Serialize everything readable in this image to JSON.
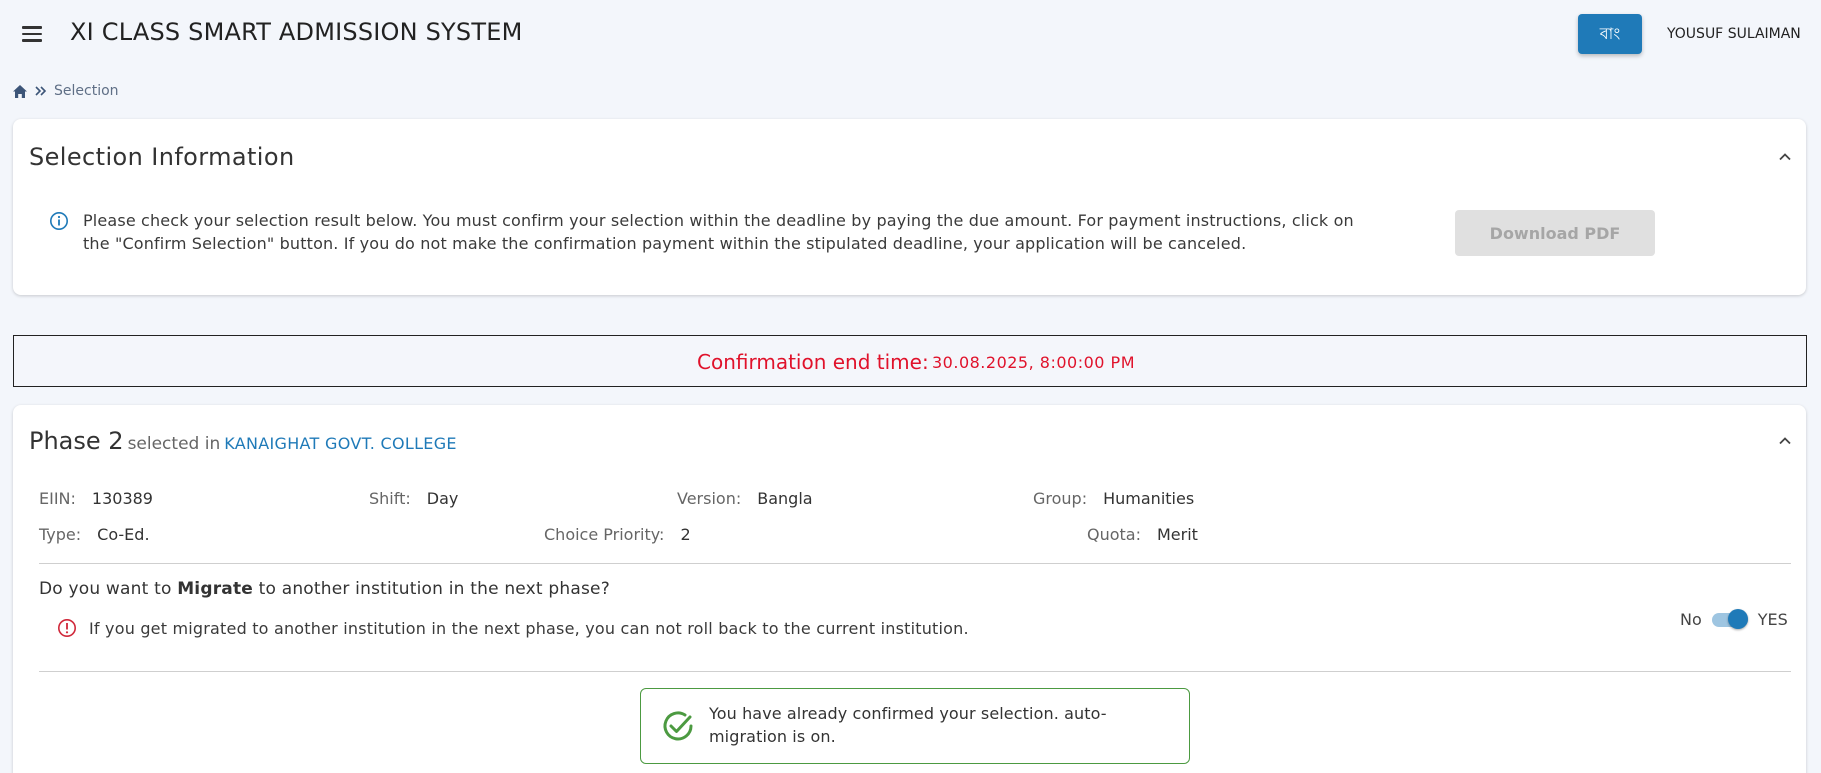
{
  "header": {
    "title": "XI CLASS SMART ADMISSION SYSTEM",
    "language_button": "বাং",
    "user_name": "YOUSUF SULAIMAN"
  },
  "breadcrumb": {
    "current": "Selection"
  },
  "selection_info": {
    "title": "Selection Information",
    "message": "Please check your selection result below. You must confirm your selection within the deadline by paying the due amount. For payment instructions, click on the \"Confirm Selection\" button. If you do not make the confirmation payment within the stipulated deadline, your application will be canceled.",
    "download_button": "Download PDF"
  },
  "confirmation": {
    "label": "Confirmation end time:",
    "value": "30.08.2025, 8:00:00 PM"
  },
  "phase": {
    "title": "Phase 2",
    "selected_in": "selected in",
    "college": "KANAIGHAT GOVT. COLLEGE",
    "fields": {
      "eiin_label": "EIIN:",
      "eiin_value": "130389",
      "shift_label": "Shift:",
      "shift_value": "Day",
      "version_label": "Version:",
      "version_value": "Bangla",
      "group_label": "Group:",
      "group_value": "Humanities",
      "type_label": "Type:",
      "type_value": "Co-Ed.",
      "priority_label": "Choice Priority:",
      "priority_value": "2",
      "quota_label": "Quota:",
      "quota_value": "Merit"
    },
    "migrate": {
      "question_prefix": "Do you want to",
      "question_bold": "Migrate",
      "question_suffix": "to another institution in the next phase?",
      "warning": "If you get migrated to another institution in the next phase, you can not roll back to the current institution.",
      "toggle_off_label": "No",
      "toggle_on_label": "YES",
      "toggle_state": "on"
    },
    "success_message": "You have already confirmed your selection. auto-migration is on."
  },
  "colors": {
    "primary": "#1f7ab8",
    "danger": "#e0122b",
    "success": "#4c9a41"
  }
}
